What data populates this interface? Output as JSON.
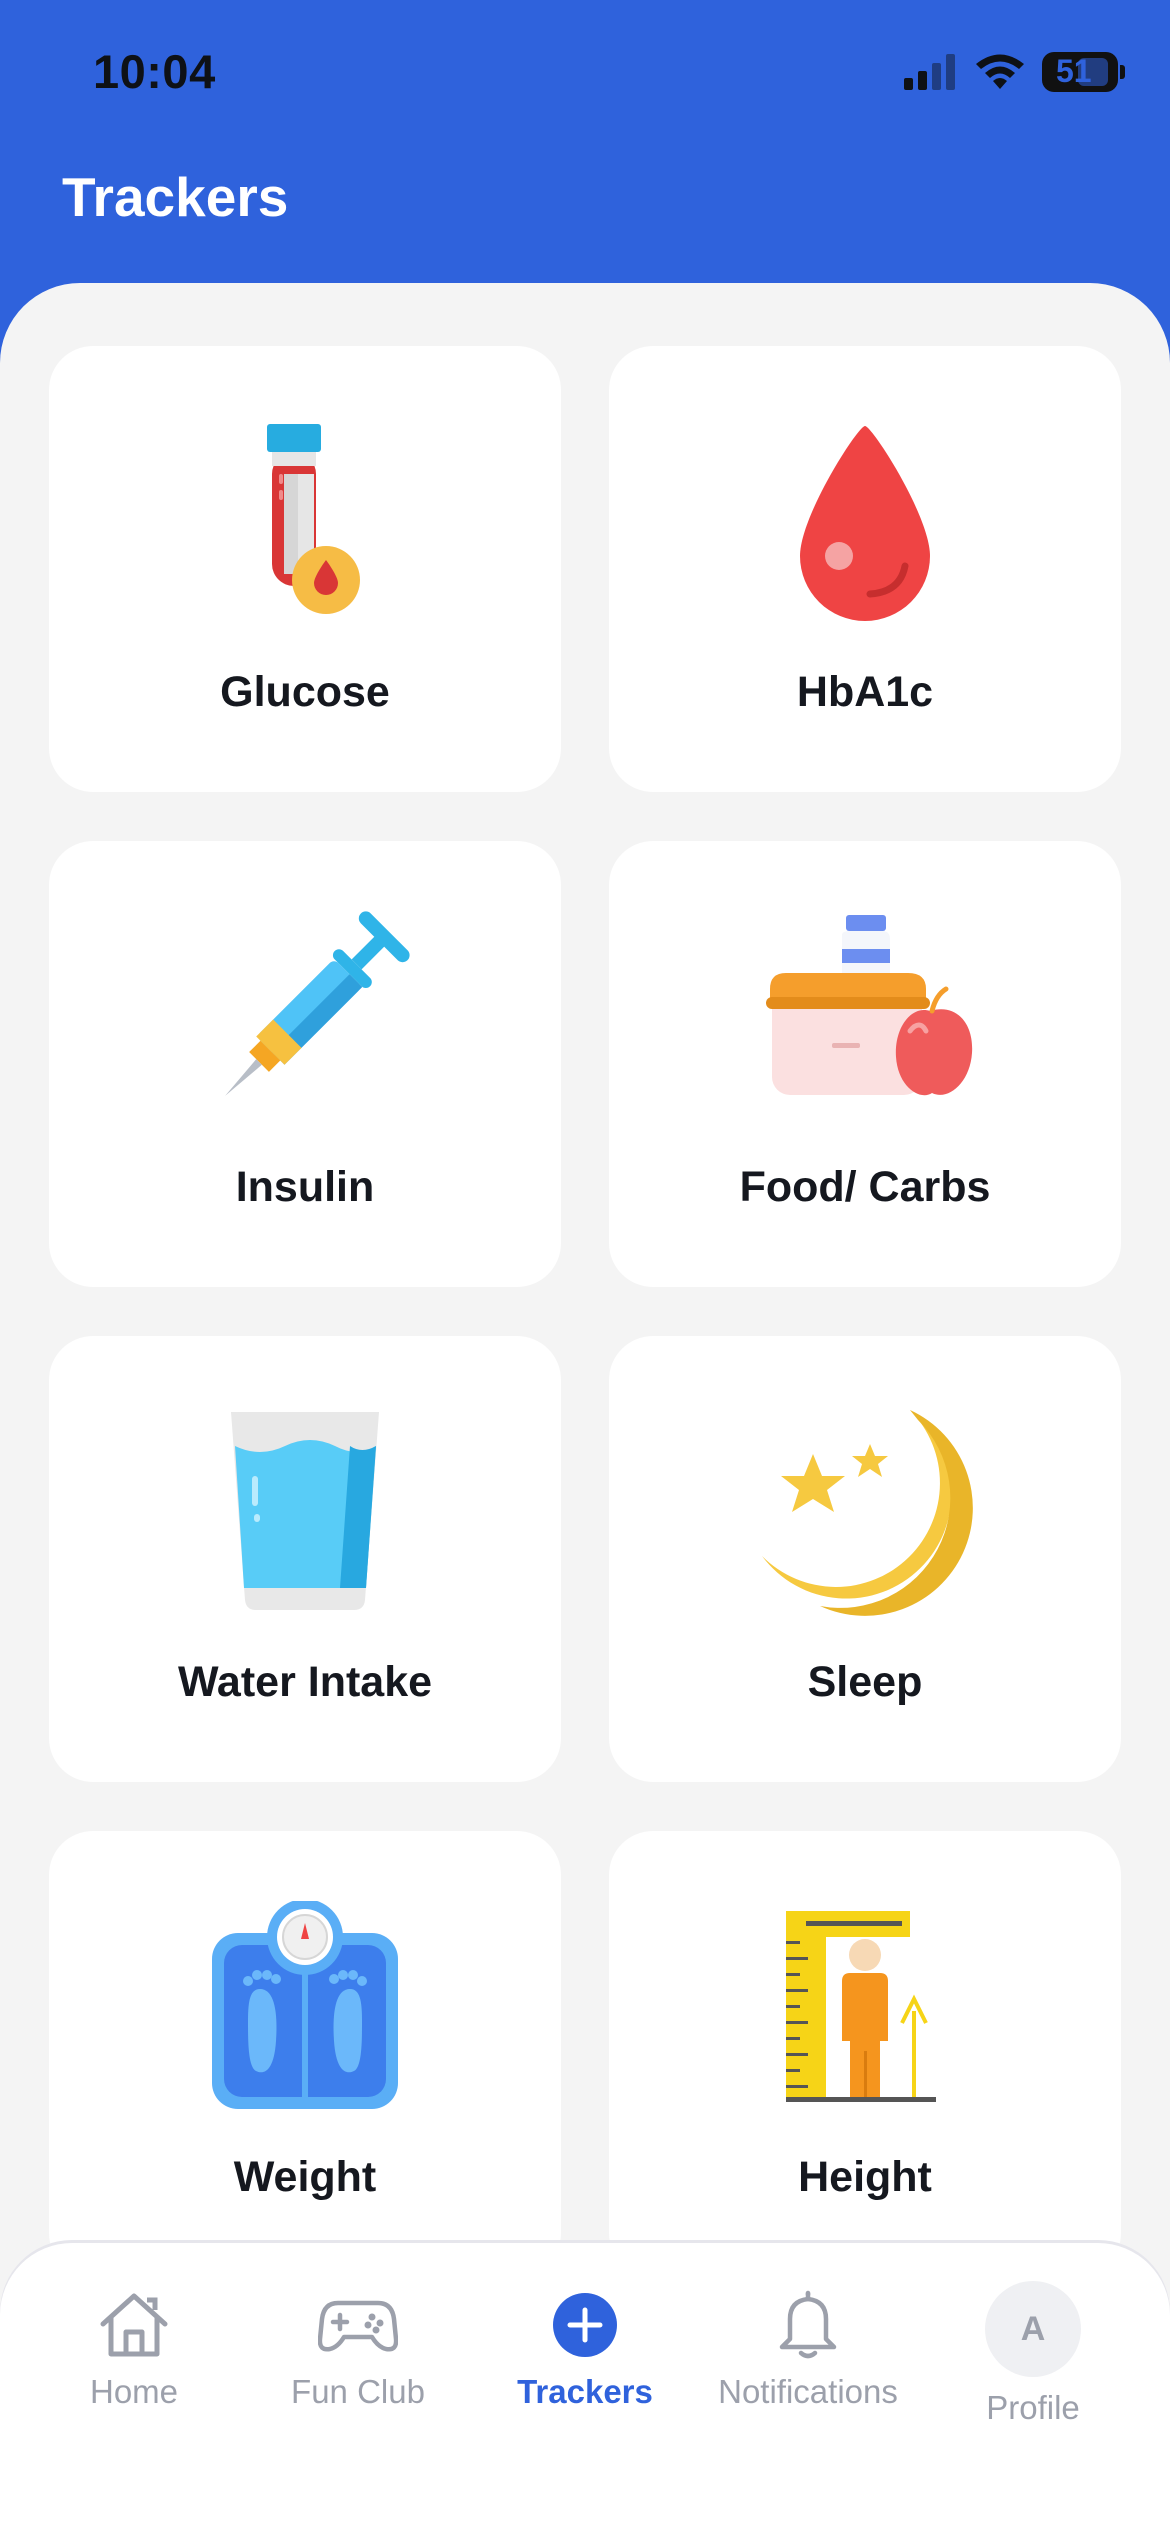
{
  "status": {
    "time": "10:04",
    "battery": "51"
  },
  "header": {
    "title": "Trackers"
  },
  "trackers": [
    {
      "label": "Glucose",
      "icon": "blood-test-tube-icon"
    },
    {
      "label": "HbA1c",
      "icon": "blood-drop-icon"
    },
    {
      "label": "Insulin",
      "icon": "syringe-icon"
    },
    {
      "label": "Food/ Carbs",
      "icon": "food-carbs-icon"
    },
    {
      "label": "Water Intake",
      "icon": "water-glass-icon"
    },
    {
      "label": "Sleep",
      "icon": "moon-stars-icon"
    },
    {
      "label": "Weight",
      "icon": "weighing-scale-icon"
    },
    {
      "label": "Height",
      "icon": "height-measure-icon"
    }
  ],
  "tabs": [
    {
      "label": "Home",
      "icon": "home-icon"
    },
    {
      "label": "Fun Club",
      "icon": "gamepad-icon"
    },
    {
      "label": "Trackers",
      "icon": "plus-circle-icon",
      "active": true
    },
    {
      "label": "Notifications",
      "icon": "bell-icon"
    },
    {
      "label": "Profile",
      "icon": "avatar",
      "initial": "A"
    }
  ],
  "colors": {
    "primary": "#2F62DC",
    "background": "#F4F4F4",
    "card": "#FFFFFF",
    "inactive": "#9CA0AB"
  }
}
